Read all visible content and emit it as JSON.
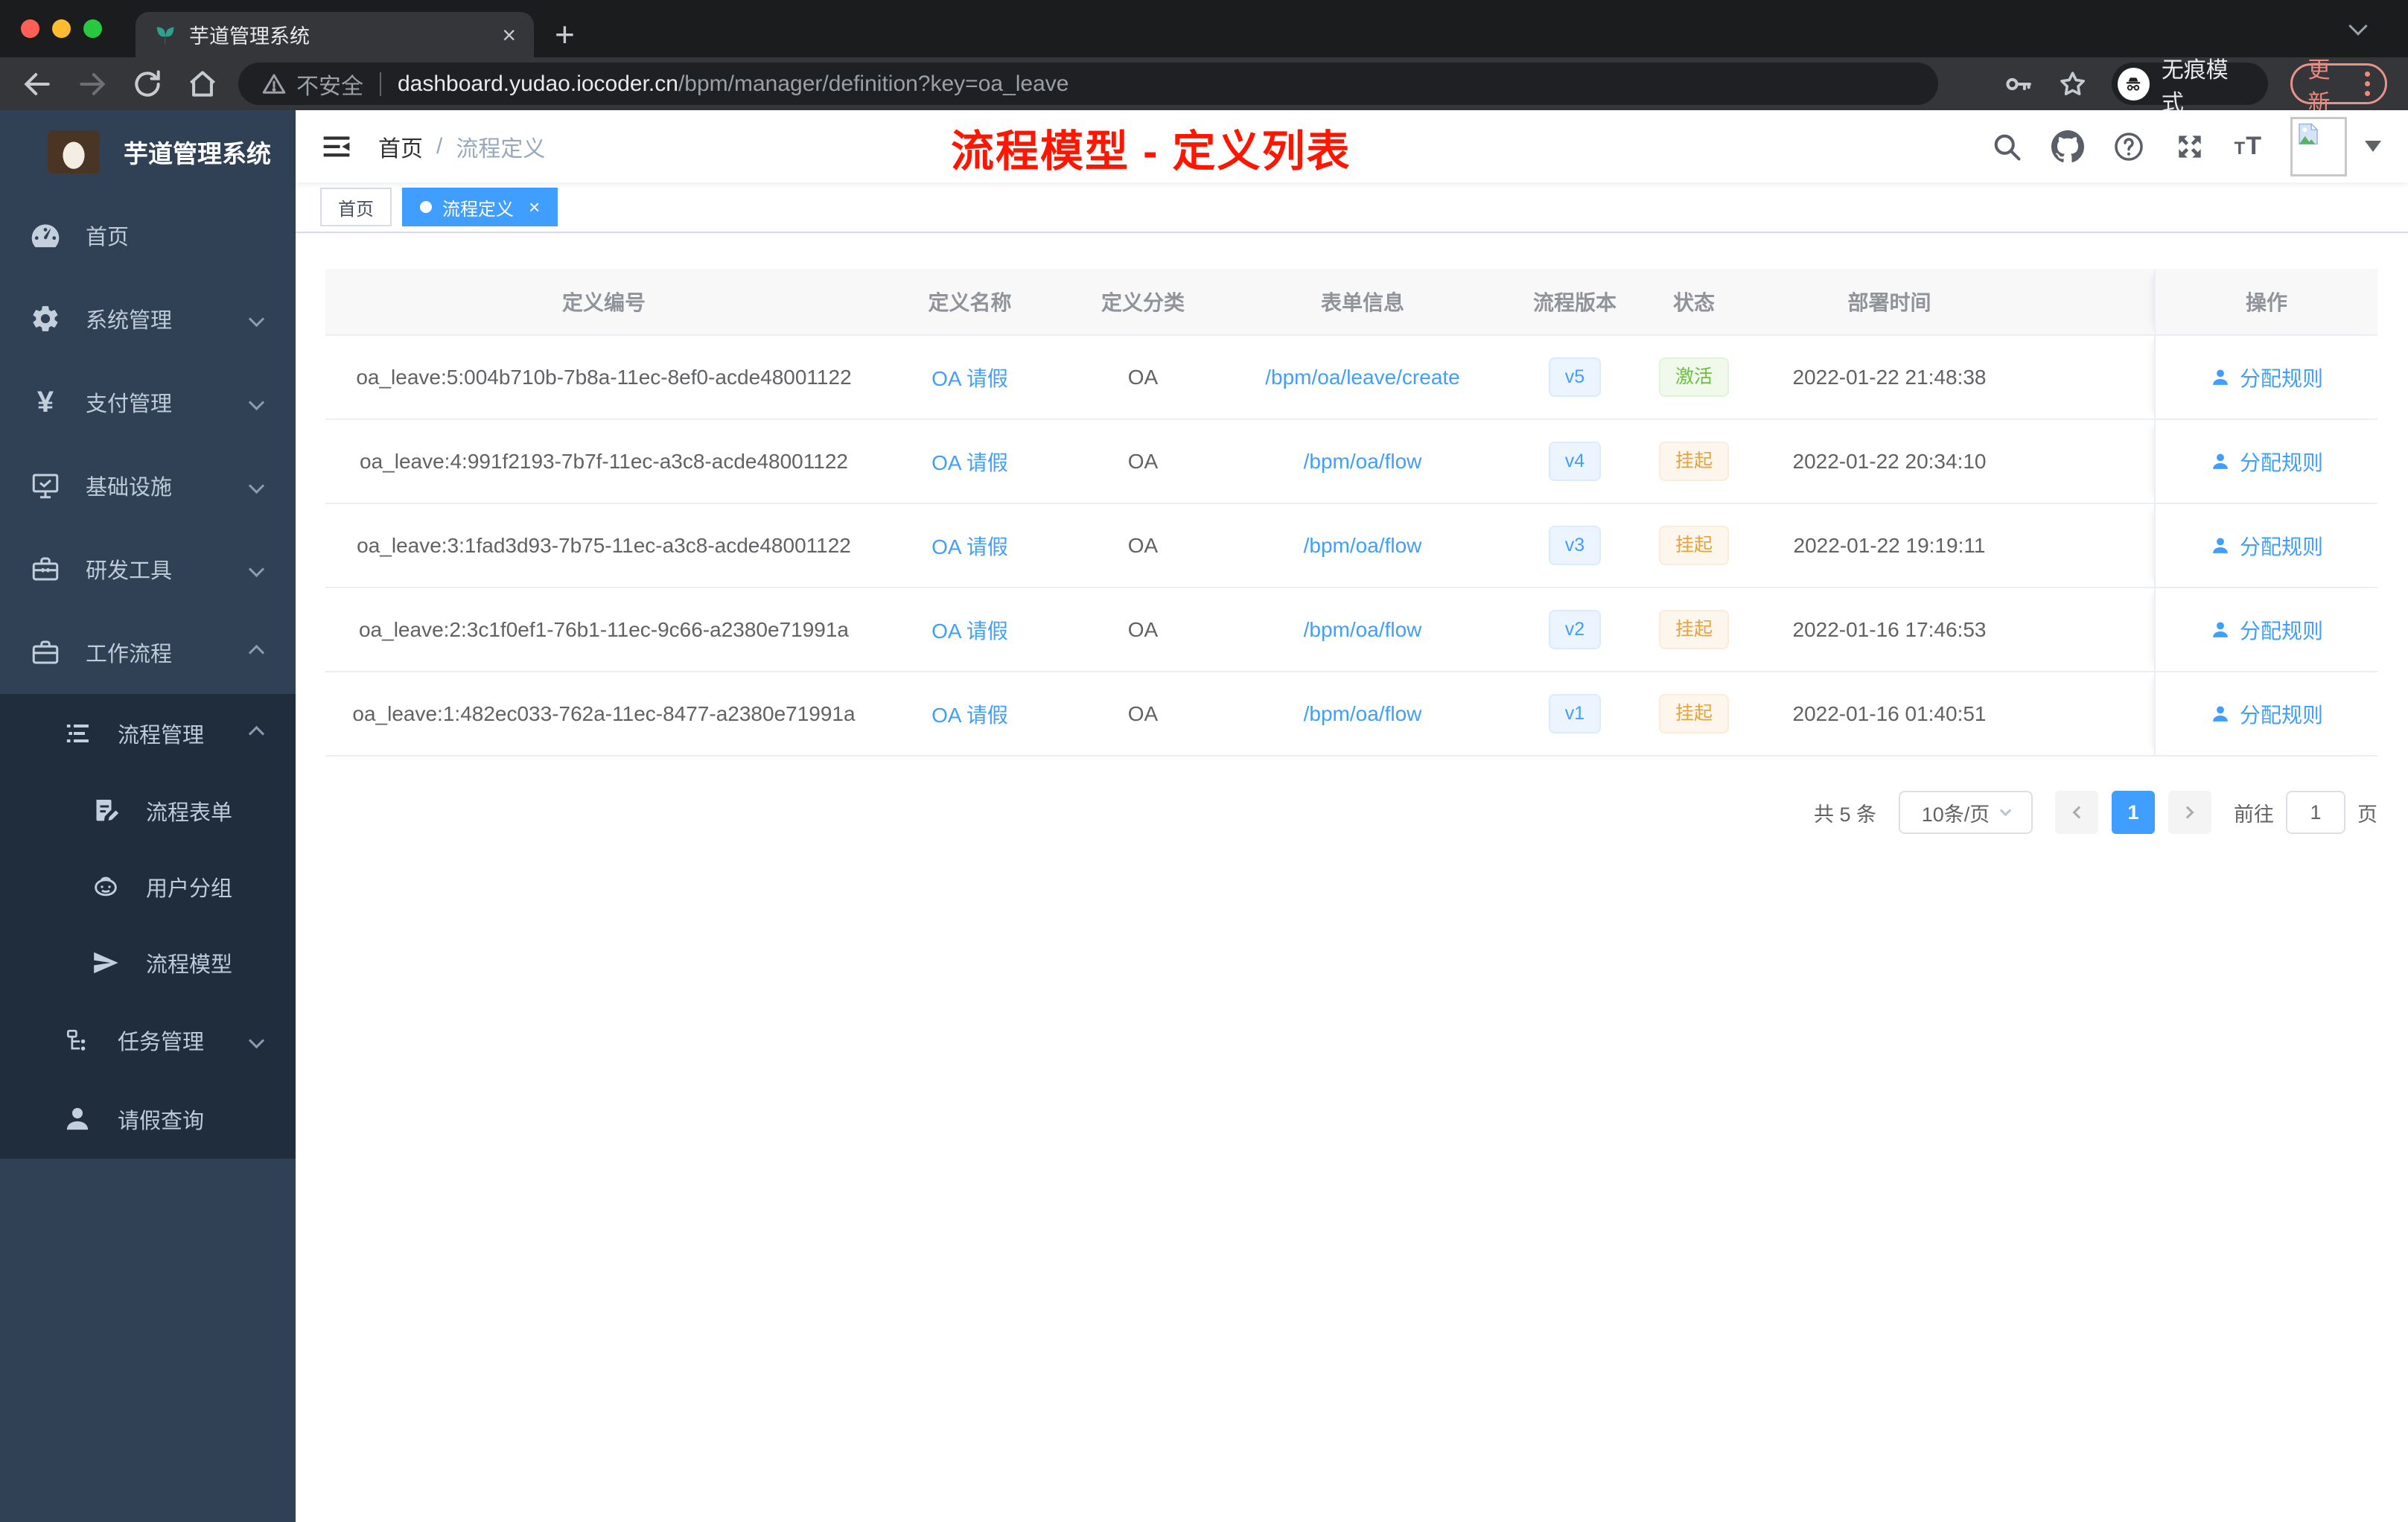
{
  "colors": {
    "accent": "#409eff",
    "success": "#67c23a",
    "warning": "#e6a23c",
    "annotation_red": "#ff1500",
    "sidebar_bg": "#304156",
    "submenu_bg": "#1f2d3d"
  },
  "browser": {
    "tab": {
      "title": "芋道管理系统",
      "close": "×",
      "favicon": "plant-icon"
    },
    "new_tab": "+",
    "address": {
      "security": "不安全",
      "host": "dashboard.yudao.iocoder.cn",
      "path": "/bpm/manager/definition?key=oa_leave"
    },
    "actions": {
      "incognito": "无痕模式",
      "update": "更新"
    }
  },
  "sidebar": {
    "logo_title": "芋道管理系统",
    "items": [
      {
        "label": "首页",
        "icon": "dashboard-icon"
      },
      {
        "label": "系统管理",
        "icon": "gear-icon"
      },
      {
        "label": "支付管理",
        "icon": "yen-icon"
      },
      {
        "label": "基础设施",
        "icon": "monitor-icon"
      },
      {
        "label": "研发工具",
        "icon": "toolbox-icon"
      },
      {
        "label": "工作流程",
        "icon": "briefcase-icon"
      },
      {
        "label": "流程管理",
        "icon": "tree-list-icon"
      },
      {
        "label": "流程表单",
        "icon": "form-icon"
      },
      {
        "label": "用户分组",
        "icon": "robot-icon"
      },
      {
        "label": "流程模型",
        "icon": "paper-plane-icon"
      },
      {
        "label": "任务管理",
        "icon": "org-icon"
      },
      {
        "label": "请假查询",
        "icon": "person-icon"
      }
    ]
  },
  "header": {
    "breadcrumb": {
      "root": "首页",
      "separator": "/",
      "current": "流程定义"
    },
    "annotation": "流程模型 - 定义列表"
  },
  "tags": {
    "items": [
      {
        "label": "首页"
      },
      {
        "label": "流程定义",
        "close": "×"
      }
    ]
  },
  "table": {
    "columns": [
      "定义编号",
      "定义名称",
      "定义分类",
      "表单信息",
      "流程版本",
      "状态",
      "部署时间",
      "操作"
    ],
    "rows": [
      {
        "id": "oa_leave:5:004b710b-7b8a-11ec-8ef0-acde48001122",
        "name": "OA 请假",
        "category": "OA",
        "form": "/bpm/oa/leave/create",
        "version": "v5",
        "status": "激活",
        "status_type": "success",
        "deploy_time": "2022-01-22 21:48:38",
        "action": "分配规则"
      },
      {
        "id": "oa_leave:4:991f2193-7b7f-11ec-a3c8-acde48001122",
        "name": "OA 请假",
        "category": "OA",
        "form": "/bpm/oa/flow",
        "version": "v4",
        "status": "挂起",
        "status_type": "warning",
        "deploy_time": "2022-01-22 20:34:10",
        "action": "分配规则"
      },
      {
        "id": "oa_leave:3:1fad3d93-7b75-11ec-a3c8-acde48001122",
        "name": "OA 请假",
        "category": "OA",
        "form": "/bpm/oa/flow",
        "version": "v3",
        "status": "挂起",
        "status_type": "warning",
        "deploy_time": "2022-01-22 19:19:11",
        "action": "分配规则"
      },
      {
        "id": "oa_leave:2:3c1f0ef1-76b1-11ec-9c66-a2380e71991a",
        "name": "OA 请假",
        "category": "OA",
        "form": "/bpm/oa/flow",
        "version": "v2",
        "status": "挂起",
        "status_type": "warning",
        "deploy_time": "2022-01-16 17:46:53",
        "action": "分配规则"
      },
      {
        "id": "oa_leave:1:482ec033-762a-11ec-8477-a2380e71991a",
        "name": "OA 请假",
        "category": "OA",
        "form": "/bpm/oa/flow",
        "version": "v1",
        "status": "挂起",
        "status_type": "warning",
        "deploy_time": "2022-01-16 01:40:51",
        "action": "分配规则"
      }
    ]
  },
  "pagination": {
    "total": "共 5 条",
    "page_size": "10条/页",
    "page": "1",
    "goto_label": "前往",
    "goto_value": "1",
    "unit": "页"
  }
}
